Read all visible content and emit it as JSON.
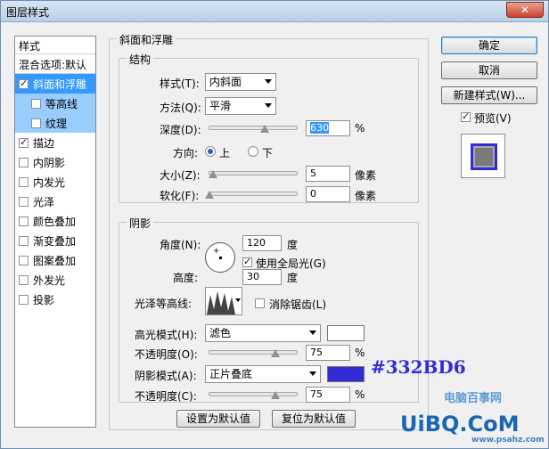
{
  "window": {
    "title": "图层样式",
    "close_glyph": "✕"
  },
  "style_list": {
    "header": "样式",
    "blend": "混合选项:默认",
    "items": [
      {
        "label": "斜面和浮雕",
        "checked": true
      },
      {
        "label": "等高线",
        "checked": false
      },
      {
        "label": "纹理",
        "checked": false
      },
      {
        "label": "描边",
        "checked": true
      },
      {
        "label": "内阴影",
        "checked": false
      },
      {
        "label": "内发光",
        "checked": false
      },
      {
        "label": "光泽",
        "checked": false
      },
      {
        "label": "颜色叠加",
        "checked": false
      },
      {
        "label": "渐变叠加",
        "checked": false
      },
      {
        "label": "图案叠加",
        "checked": false
      },
      {
        "label": "外发光",
        "checked": false
      },
      {
        "label": "投影",
        "checked": false
      }
    ]
  },
  "bevel": {
    "title": "斜面和浮雕",
    "structure": {
      "title": "结构",
      "style_label": "样式(T):",
      "style_value": "内斜面",
      "technique_label": "方法(Q):",
      "technique_value": "平滑",
      "depth_label": "深度(D):",
      "depth_value": "630",
      "depth_unit": "%",
      "direction_label": "方向:",
      "direction_up": "上",
      "direction_down": "下",
      "size_label": "大小(Z):",
      "size_value": "5",
      "size_unit": "像素",
      "soften_label": "软化(F):",
      "soften_value": "0",
      "soften_unit": "像素"
    },
    "shading": {
      "title": "阴影",
      "angle_label": "角度(N):",
      "angle_value": "120",
      "angle_unit": "度",
      "global_light_label": "使用全局光(G)",
      "altitude_label": "高度:",
      "altitude_value": "30",
      "altitude_unit": "度",
      "gloss_label": "光泽等高线:",
      "antialias_label": "消除锯齿(L)",
      "highlight_label": "高光模式(H):",
      "highlight_value": "滤色",
      "highlight_color": "#ffffff",
      "h_opacity_label": "不透明度(O):",
      "h_opacity_value": "75",
      "h_opacity_unit": "%",
      "shadow_label": "阴影模式(A):",
      "shadow_value": "正片叠底",
      "shadow_color": "#332bd6",
      "s_opacity_label": "不透明度(C):",
      "s_opacity_value": "75",
      "s_opacity_unit": "%"
    },
    "make_default": "设置为默认值",
    "reset_default": "复位为默认值"
  },
  "buttons": {
    "ok": "确定",
    "cancel": "取消",
    "new_style": "新建样式(W)...",
    "preview": "预览(V)"
  },
  "annotation": "#332BD6",
  "watermark": {
    "text": "UiBQ.CoM",
    "sub": "电脑百事网",
    "url": "www.psahz.com"
  }
}
